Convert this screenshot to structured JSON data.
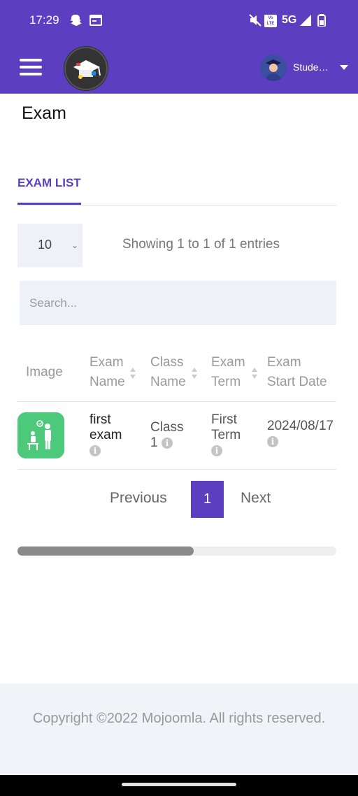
{
  "status_bar": {
    "time": "17:29",
    "network": "5G",
    "volte": "Vo LTE",
    "icons": [
      "snapchat-icon",
      "calendar-icon",
      "mute-icon",
      "volte-icon",
      "signal-icon",
      "battery-icon"
    ]
  },
  "app_bar": {
    "user_name": "Stude…",
    "brand_color": "#5b3fc0"
  },
  "page": {
    "title": "Exam",
    "tab_label": "EXAM LIST"
  },
  "table_controls": {
    "page_length": "10",
    "info": "Showing 1 to 1 of 1 entries",
    "search_placeholder": "Search..."
  },
  "table": {
    "headers": {
      "image": "Image",
      "exam_name_1": "Exam",
      "exam_name_2": "Name",
      "class_name_1": "Class",
      "class_name_2": "Name",
      "exam_term_1": "Exam",
      "exam_term_2": "Term",
      "exam_start_1": "Exam",
      "exam_start_2": "Start Date"
    },
    "rows": [
      {
        "exam_name_1": "first",
        "exam_name_2": "exam",
        "class_name_1": "Class",
        "class_name_2": "1",
        "exam_term_1": "First",
        "exam_term_2": "Term",
        "exam_start": "2024/08/17"
      }
    ]
  },
  "pagination": {
    "previous": "Previous",
    "current": "1",
    "next": "Next"
  },
  "footer": {
    "copyright": "Copyright ©2022 Mojoomla. All rights reserved."
  }
}
